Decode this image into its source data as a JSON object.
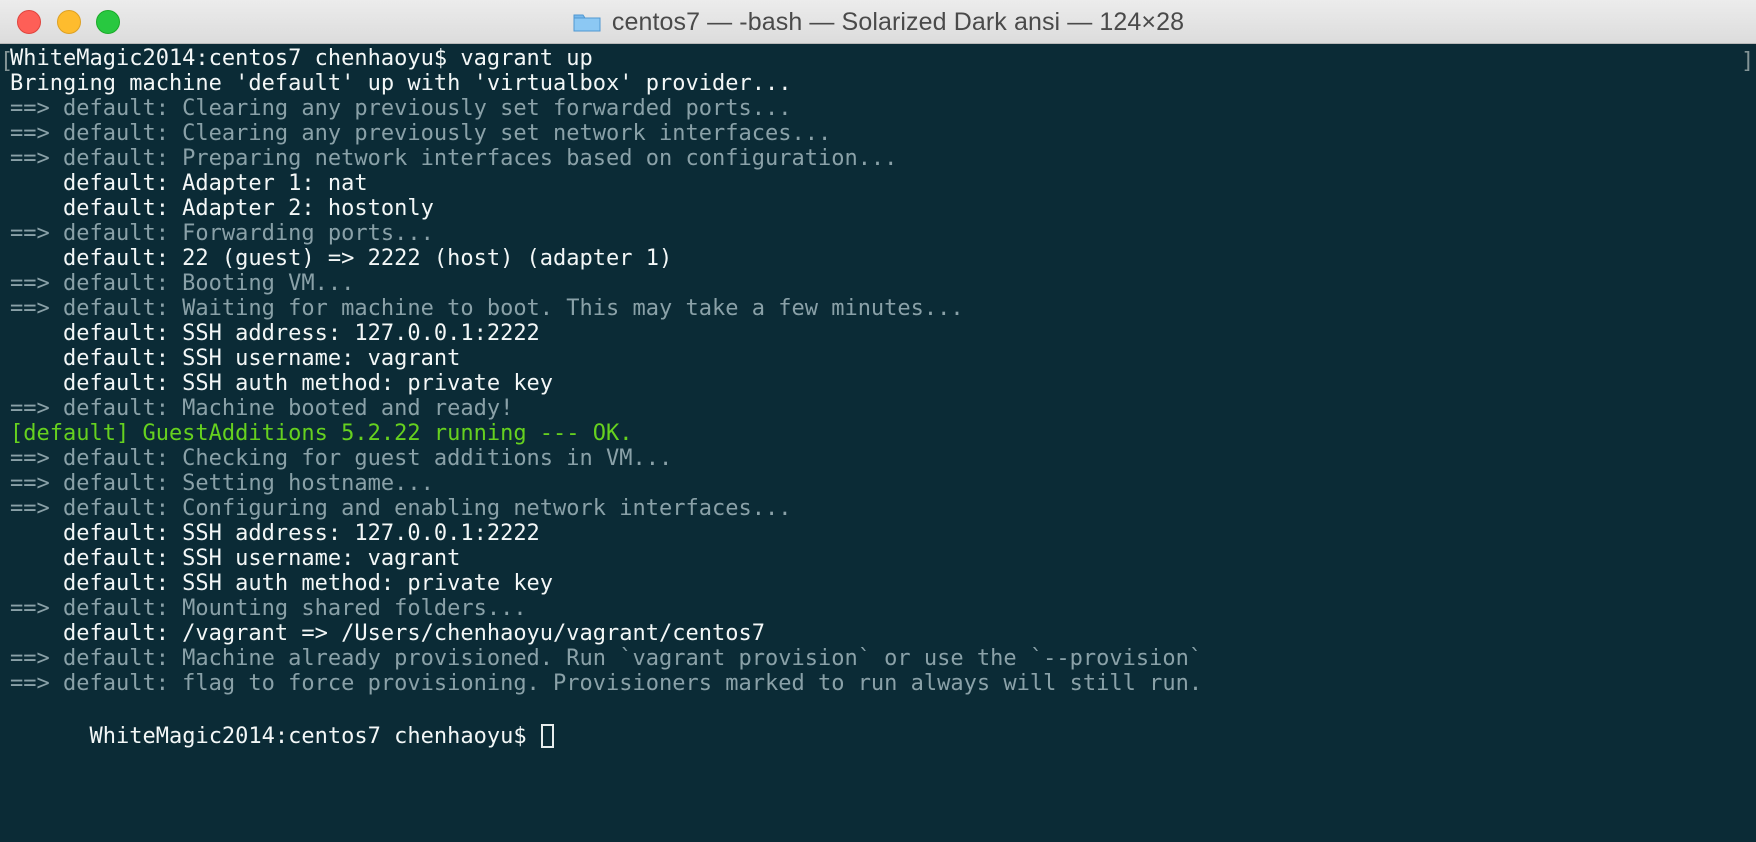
{
  "window": {
    "title": "centos7 — -bash — Solarized Dark ansi — 124×28"
  },
  "terminal": {
    "left_bracket": "[",
    "right_bracket": "]",
    "lines": [
      "WhiteMagic2014:centos7 chenhaoyu$ vagrant up",
      "Bringing machine 'default' up with 'virtualbox' provider...",
      "==> default: Clearing any previously set forwarded ports...",
      "==> default: Clearing any previously set network interfaces...",
      "==> default: Preparing network interfaces based on configuration...",
      "    default: Adapter 1: nat",
      "    default: Adapter 2: hostonly",
      "==> default: Forwarding ports...",
      "    default: 22 (guest) => 2222 (host) (adapter 1)",
      "==> default: Booting VM...",
      "==> default: Waiting for machine to boot. This may take a few minutes...",
      "    default: SSH address: 127.0.0.1:2222",
      "    default: SSH username: vagrant",
      "    default: SSH auth method: private key",
      "==> default: Machine booted and ready!",
      "[default] GuestAdditions 5.2.22 running --- OK.",
      "==> default: Checking for guest additions in VM...",
      "==> default: Setting hostname...",
      "==> default: Configuring and enabling network interfaces...",
      "    default: SSH address: 127.0.0.1:2222",
      "    default: SSH username: vagrant",
      "    default: SSH auth method: private key",
      "==> default: Mounting shared folders...",
      "    default: /vagrant => /Users/chenhaoyu/vagrant/centos7",
      "==> default: Machine already provisioned. Run `vagrant provision` or use the `--provision`",
      "==> default: flag to force provisioning. Provisioners marked to run always will still run.",
      "WhiteMagic2014:centos7 chenhaoyu$ "
    ]
  },
  "colors": {
    "terminal_background": "#0b2b36",
    "bright_text": "#f3f7f7",
    "muted_text": "#8aa1a8",
    "success_text": "#66d11f"
  },
  "icons": {
    "folder": "folder-icon",
    "cursor": "terminal-cursor"
  }
}
